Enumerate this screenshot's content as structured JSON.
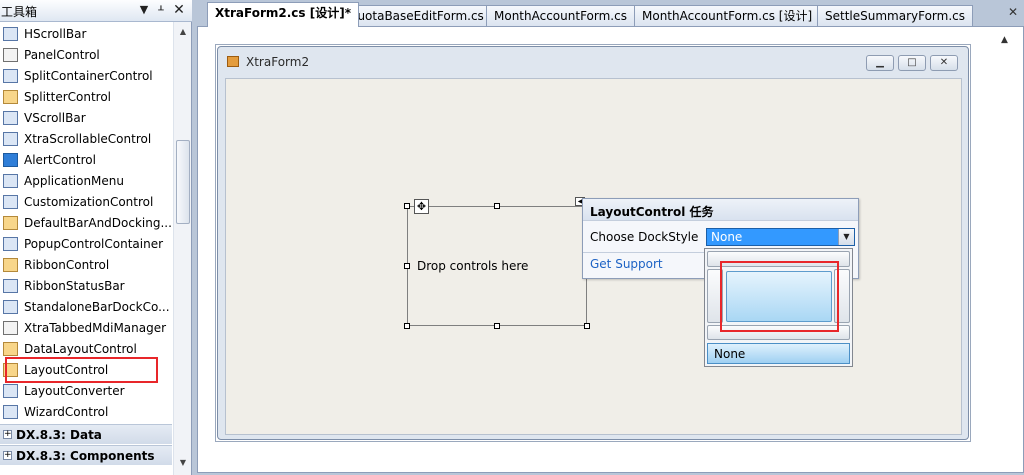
{
  "toolbox": {
    "title": "工具箱",
    "header_icons": [
      "dropdown-icon",
      "pin-icon",
      "close-icon"
    ],
    "items": [
      {
        "label": "HScrollBar",
        "icon": "hscrollbar-icon"
      },
      {
        "label": "PanelControl",
        "icon": "panel-icon"
      },
      {
        "label": "SplitContainerControl",
        "icon": "split-container-icon"
      },
      {
        "label": "SplitterControl",
        "icon": "splitter-icon"
      },
      {
        "label": "VScrollBar",
        "icon": "vscrollbar-icon"
      },
      {
        "label": "XtraScrollableControl",
        "icon": "scrollable-icon"
      },
      {
        "label": "AlertControl",
        "icon": "alert-icon"
      },
      {
        "label": "ApplicationMenu",
        "icon": "application-menu-icon"
      },
      {
        "label": "CustomizationControl",
        "icon": "customization-icon"
      },
      {
        "label": "DefaultBarAndDocking...",
        "icon": "bar-docking-icon"
      },
      {
        "label": "PopupControlContainer",
        "icon": "popup-container-icon"
      },
      {
        "label": "RibbonControl",
        "icon": "ribbon-icon"
      },
      {
        "label": "RibbonStatusBar",
        "icon": "ribbon-statusbar-icon"
      },
      {
        "label": "StandaloneBarDockCo...",
        "icon": "standalone-bar-icon"
      },
      {
        "label": "XtraTabbedMdiManager",
        "icon": "tabbed-mdi-icon"
      },
      {
        "label": "DataLayoutControl",
        "icon": "data-layout-icon"
      },
      {
        "label": "LayoutControl",
        "icon": "layout-control-icon"
      },
      {
        "label": "LayoutConverter",
        "icon": "layout-converter-icon"
      },
      {
        "label": "WizardControl",
        "icon": "wizard-icon"
      }
    ],
    "categories": [
      {
        "label": "DX.8.3: Data"
      },
      {
        "label": "DX.8.3: Components"
      }
    ]
  },
  "tabs": [
    {
      "label": "XtraForm2.cs [设计]*",
      "active": true
    },
    {
      "label": "QuotaBaseEditForm.cs",
      "active": false
    },
    {
      "label": "MonthAccountForm.cs",
      "active": false
    },
    {
      "label": "MonthAccountForm.cs [设计]",
      "active": false
    },
    {
      "label": "SettleSummaryForm.cs",
      "active": false
    }
  ],
  "form": {
    "title": "XtraForm2",
    "window_buttons": [
      "minimize-icon",
      "maximize-icon",
      "close-icon"
    ]
  },
  "layout_control": {
    "placeholder": "Drop controls here"
  },
  "tasks": {
    "title": "LayoutControl 任务",
    "dock_label": "Choose DockStyle",
    "dock_value": "None",
    "support_link": "Get Support"
  },
  "dock_dropdown": {
    "none_option": "None"
  },
  "colors": {
    "highlight": "#e8262a",
    "selection": "#3399ff",
    "link": "#1c62c4"
  }
}
